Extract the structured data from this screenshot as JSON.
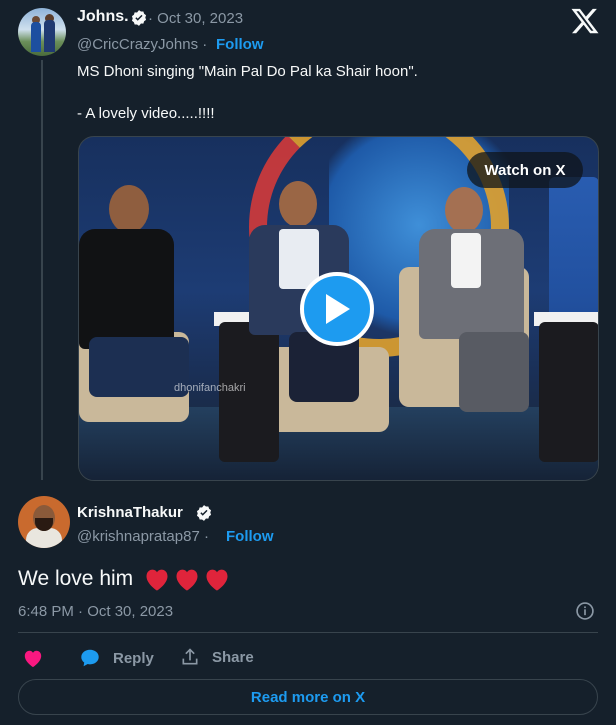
{
  "parent_tweet": {
    "author_name": "Johns.",
    "date": "· Oct 30, 2023",
    "handle": "@CricCrazyJohns ·",
    "follow_label": "Follow",
    "text": "MS Dhoni singing \"Main Pal Do Pal ka Shair hoon\".\n\n- A lovely video.....!!!!",
    "video": {
      "watch_label": "Watch on X",
      "watermark": "dhonifanchakri"
    }
  },
  "reply_tweet": {
    "author_name": "KrishnaThakur",
    "handle": "@krishnapratap87 ·",
    "follow_label": "Follow",
    "text": "We love him",
    "timestamp": "6:48 PM · Oct 30, 2023"
  },
  "actions": {
    "reply_label": "Reply",
    "share_label": "Share"
  },
  "footer": {
    "read_more_label": "Read more on X"
  },
  "colors": {
    "background": "#15202b",
    "accent": "#1d9bf0",
    "muted": "#8b98a5",
    "heart": "#f91880",
    "emoji_heart": "#e0243b"
  },
  "icons": [
    "x-logo-icon",
    "verified-badge-icon",
    "play-icon",
    "heart-icon",
    "reply-bubble-icon",
    "share-icon",
    "info-icon"
  ]
}
